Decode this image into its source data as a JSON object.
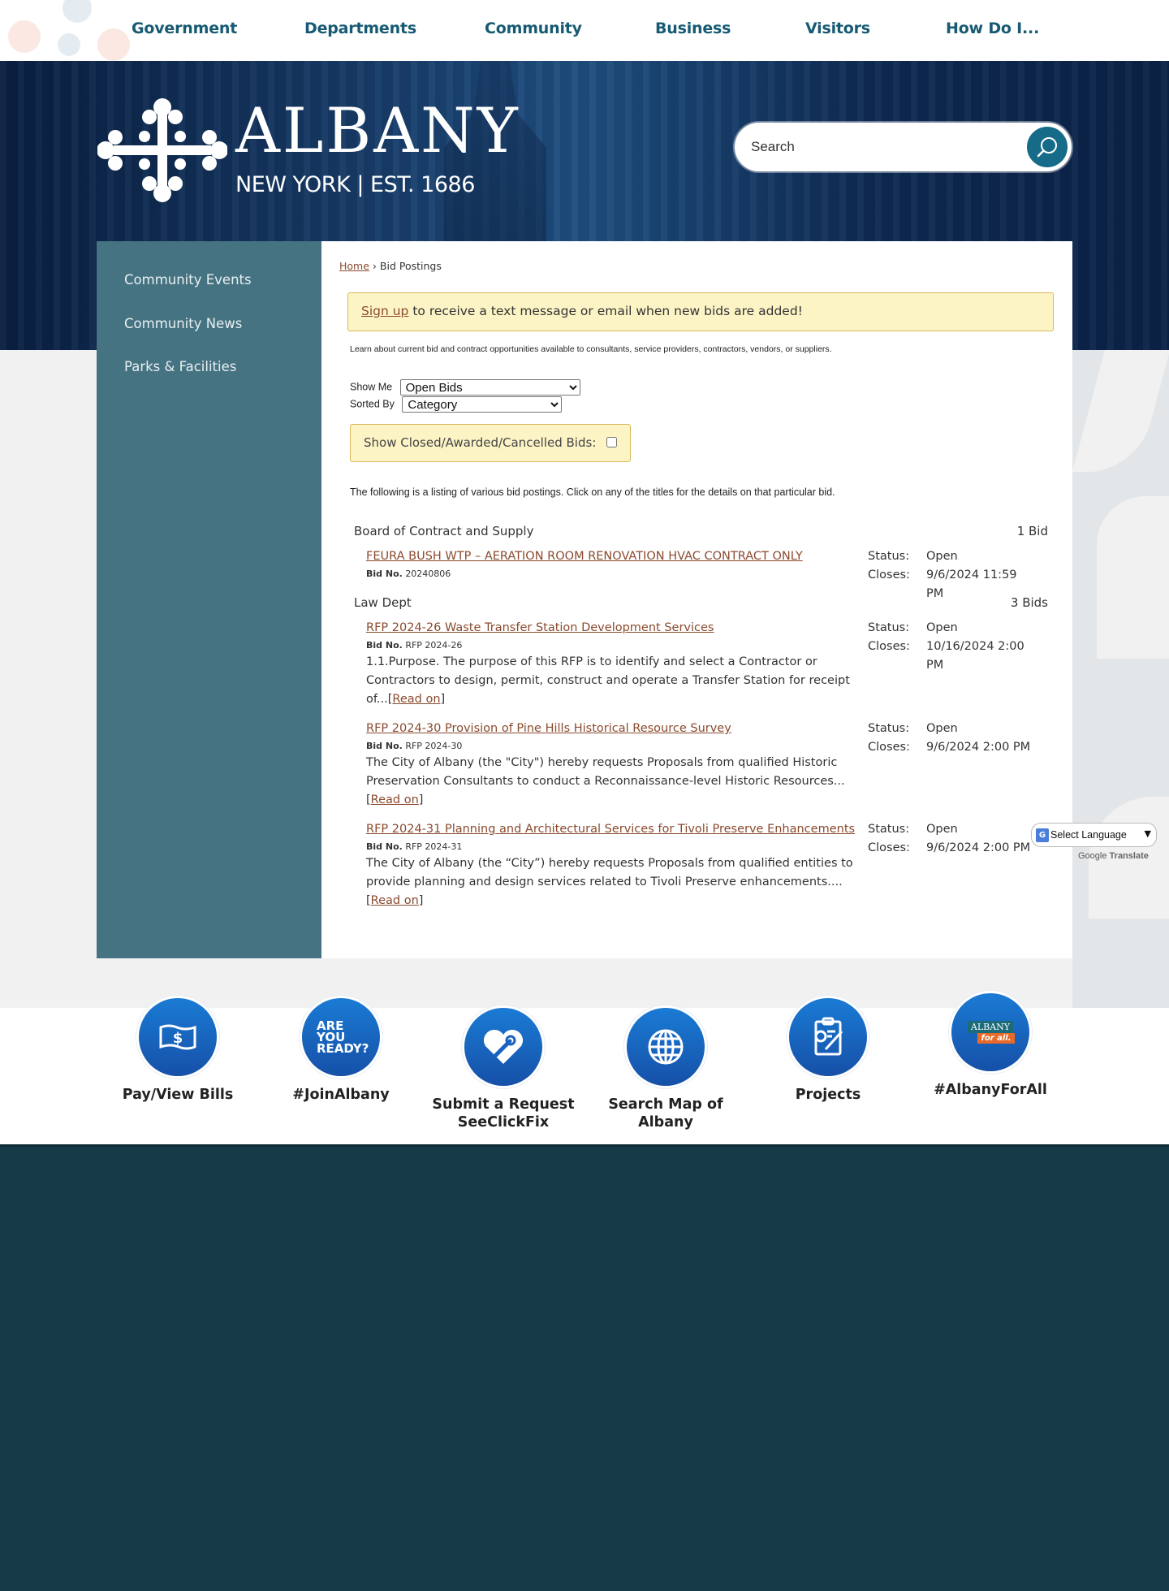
{
  "nav": {
    "items": [
      "Government",
      "Departments",
      "Community",
      "Business",
      "Visitors",
      "How Do I..."
    ]
  },
  "header": {
    "logo_word": "ALBANY",
    "logo_sub": "NEW YORK | EST. 1686",
    "search_placeholder": "Search"
  },
  "sidebar": {
    "items": [
      "Community Events",
      "Community News",
      "Parks & Facilities"
    ]
  },
  "breadcrumb": {
    "home": "Home",
    "separator": "›",
    "current": "Bid Postings"
  },
  "signup": {
    "link": "Sign up",
    "text": " to receive a text message or email when new bids are added!"
  },
  "intro": "Learn about current bid and contract opportunities available to consultants, service providers, contractors, vendors, or suppliers.",
  "filters": {
    "show_me_label": "Show Me",
    "show_me_value": "Open Bids",
    "sorted_by_label": "Sorted By",
    "sorted_by_value": "Category",
    "closed_label": "Show Closed/Awarded/Cancelled Bids:"
  },
  "listing_note": "The following is a listing of various bid postings. Click on any of the titles for the details on that particular bid.",
  "labels": {
    "status": "Status:",
    "closes": "Closes:",
    "bid_no": "Bid No.",
    "read_on": "Read on"
  },
  "categories": [
    {
      "name": "Board of Contract and Supply",
      "count": "1 Bid",
      "bids": [
        {
          "title": "FEURA BUSH WTP – AERATION ROOM RENOVATION HVAC CONTRACT ONLY",
          "bid_no": "20240806",
          "description": "",
          "status": "Open",
          "closes": "9/6/2024 11:59 PM"
        }
      ]
    },
    {
      "name": "Law Dept",
      "count": "3 Bids",
      "bids": [
        {
          "title": "RFP 2024-26 Waste Transfer Station Development Services",
          "bid_no": "RFP 2024-26",
          "description": "1.1.Purpose. The purpose of this RFP is to identify and select a Contractor or Contractors to design, permit, construct and operate a Transfer Station for receipt of...",
          "status": "Open",
          "closes": "10/16/2024 2:00 PM"
        },
        {
          "title": "RFP 2024-30 Provision of Pine Hills Historical Resource Survey",
          "bid_no": "RFP 2024-30",
          "description": "The City of Albany (the \"City\") hereby requests Proposals from qualified Historic Preservation Consultants to conduct a Reconnaissance-level Historic Resources...",
          "status": "Open",
          "closes": "9/6/2024 2:00 PM"
        },
        {
          "title": "RFP 2024-31 Planning and Architectural Services for Tivoli Preserve Enhancements",
          "bid_no": "RFP 2024-31",
          "description": "The City of Albany (the “City”) hereby requests Proposals from qualified entities to provide planning and design services related to Tivoli Preserve enhancements....",
          "status": "Open",
          "closes": "9/6/2024 2:00 PM"
        }
      ]
    }
  ],
  "translate": {
    "label": "Select Language",
    "credit_google": "Google",
    "credit_translate": "Translate"
  },
  "quick_links": [
    {
      "label": "Pay/View Bills",
      "icon": "money-bill-icon"
    },
    {
      "label": "#JoinAlbany",
      "icon": "are-you-ready-icon",
      "icon_text": "ARE YOU READY?"
    },
    {
      "label": "Submit a Request SeeClickFix",
      "icon": "heart-wrench-icon"
    },
    {
      "label": "Search Map of Albany",
      "icon": "globe-icon"
    },
    {
      "label": "Projects",
      "icon": "clipboard-gear-icon"
    },
    {
      "label": "#AlbanyForAll",
      "icon": "albany-for-all-icon",
      "icon_text": "ALBANY",
      "icon_text2": "for all."
    }
  ],
  "colors": {
    "nav_text": "#165a73",
    "sidebar_bg": "#467382",
    "link": "#8a4a2e",
    "notice_bg": "#fdf4c6",
    "notice_border": "#d8b85c",
    "quick_link_blue": "#1a6fc4",
    "footer_bg": "#163a48"
  }
}
